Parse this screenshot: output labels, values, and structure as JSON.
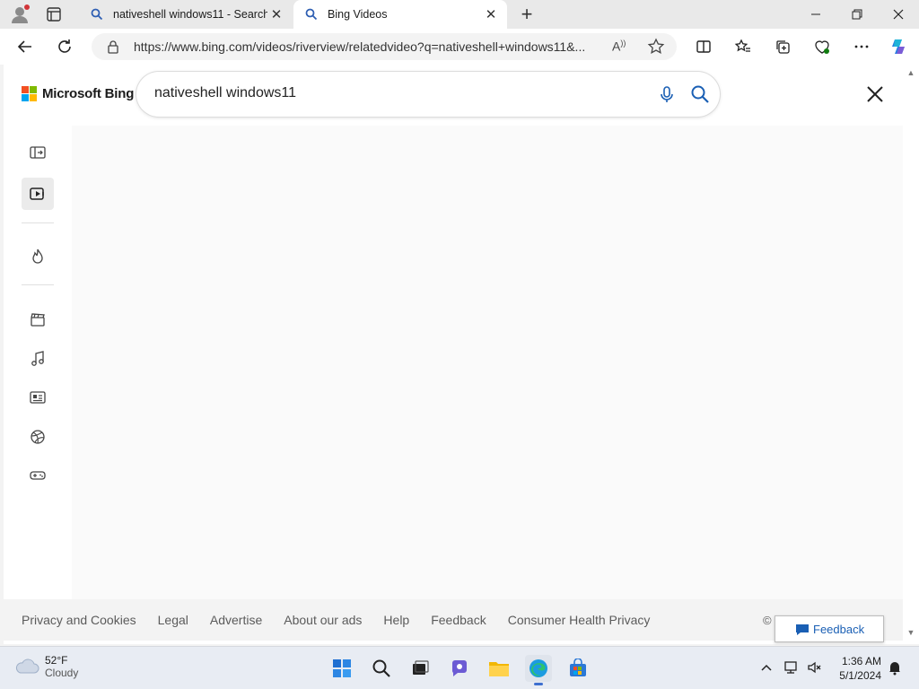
{
  "tabs": [
    {
      "title": "nativeshell windows11 - Search",
      "active": false
    },
    {
      "title": "Bing Videos",
      "active": true
    }
  ],
  "address_bar": {
    "url": "https://www.bing.com/videos/riverview/relatedvideo?q=nativeshell+windows11&..."
  },
  "header": {
    "logo_text": "Microsoft Bing",
    "search_query": "nativeshell windows11"
  },
  "sidebar": {
    "items": [
      {
        "icon": "expand-panel-icon"
      },
      {
        "icon": "video-play-icon",
        "active": true
      },
      {
        "icon": "flame-icon"
      },
      {
        "icon": "clapperboard-icon"
      },
      {
        "icon": "music-note-icon"
      },
      {
        "icon": "news-icon"
      },
      {
        "icon": "sports-ball-icon"
      },
      {
        "icon": "gamepad-icon"
      }
    ]
  },
  "footer": {
    "links": [
      "Privacy and Cookies",
      "Legal",
      "Advertise",
      "About our ads",
      "Help",
      "Feedback",
      "Consumer Health Privacy"
    ],
    "copyright_fragment": "©",
    "feedback_button": "Feedback"
  },
  "taskbar": {
    "weather": {
      "temp": "52°F",
      "condition": "Cloudy"
    },
    "apps": [
      "start-icon",
      "search-icon",
      "task-view-icon",
      "teams-chat-icon",
      "file-explorer-icon",
      "edge-icon",
      "store-icon"
    ],
    "clock": {
      "time": "1:36 AM",
      "date": "5/1/2024"
    }
  },
  "colors": {
    "ms_red": "#f25022",
    "ms_green": "#7fba00",
    "ms_blue": "#00a4ef",
    "ms_yellow": "#ffb900",
    "accent_blue": "#1a5fb4"
  }
}
